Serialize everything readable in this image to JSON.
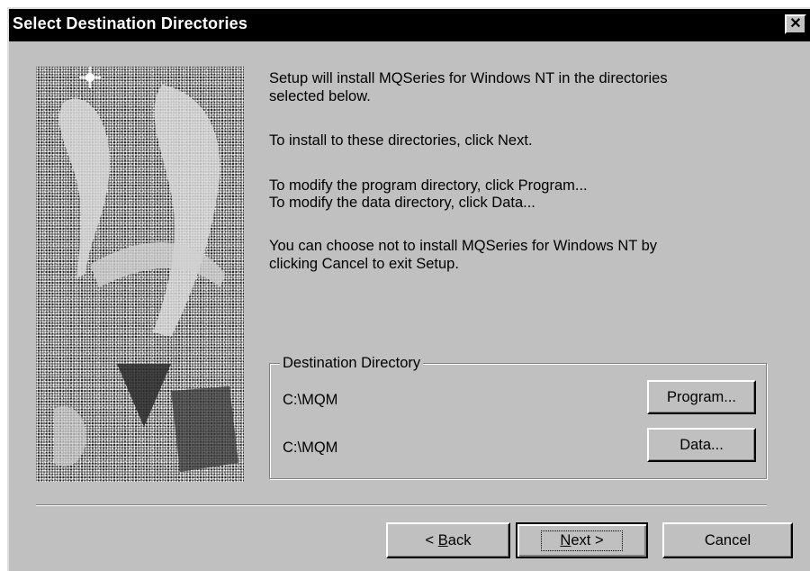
{
  "window": {
    "title": "Select Destination Directories",
    "close_glyph": "✕"
  },
  "content": {
    "intro_line1": "Setup will install MQSeries for Windows NT in the directories",
    "intro_line2": "selected below.",
    "next_instruction": "To install to these directories, click Next.",
    "program_instruction": "To modify the program directory, click Program...",
    "data_instruction": "To modify the data directory, click Data...",
    "cancel_line1": "You can choose not to install MQSeries for Windows NT by",
    "cancel_line2": "clicking Cancel to exit Setup."
  },
  "destination": {
    "group_label": "Destination Directory",
    "program_path": "C:\\MQM",
    "program_button": "Program...",
    "data_path": "C:\\MQM",
    "data_button": "Data..."
  },
  "buttons": {
    "back_prefix": "< ",
    "back_mnemonic": "B",
    "back_rest": "ack",
    "next_mnemonic": "N",
    "next_rest": "ext >",
    "cancel": "Cancel"
  },
  "colors": {
    "dialog_bg": "#c0c0c0",
    "titlebar_bg": "#000000",
    "titlebar_text": "#ffffff"
  },
  "icons": {
    "close": "close-icon",
    "illustration": "setup-illustration"
  }
}
